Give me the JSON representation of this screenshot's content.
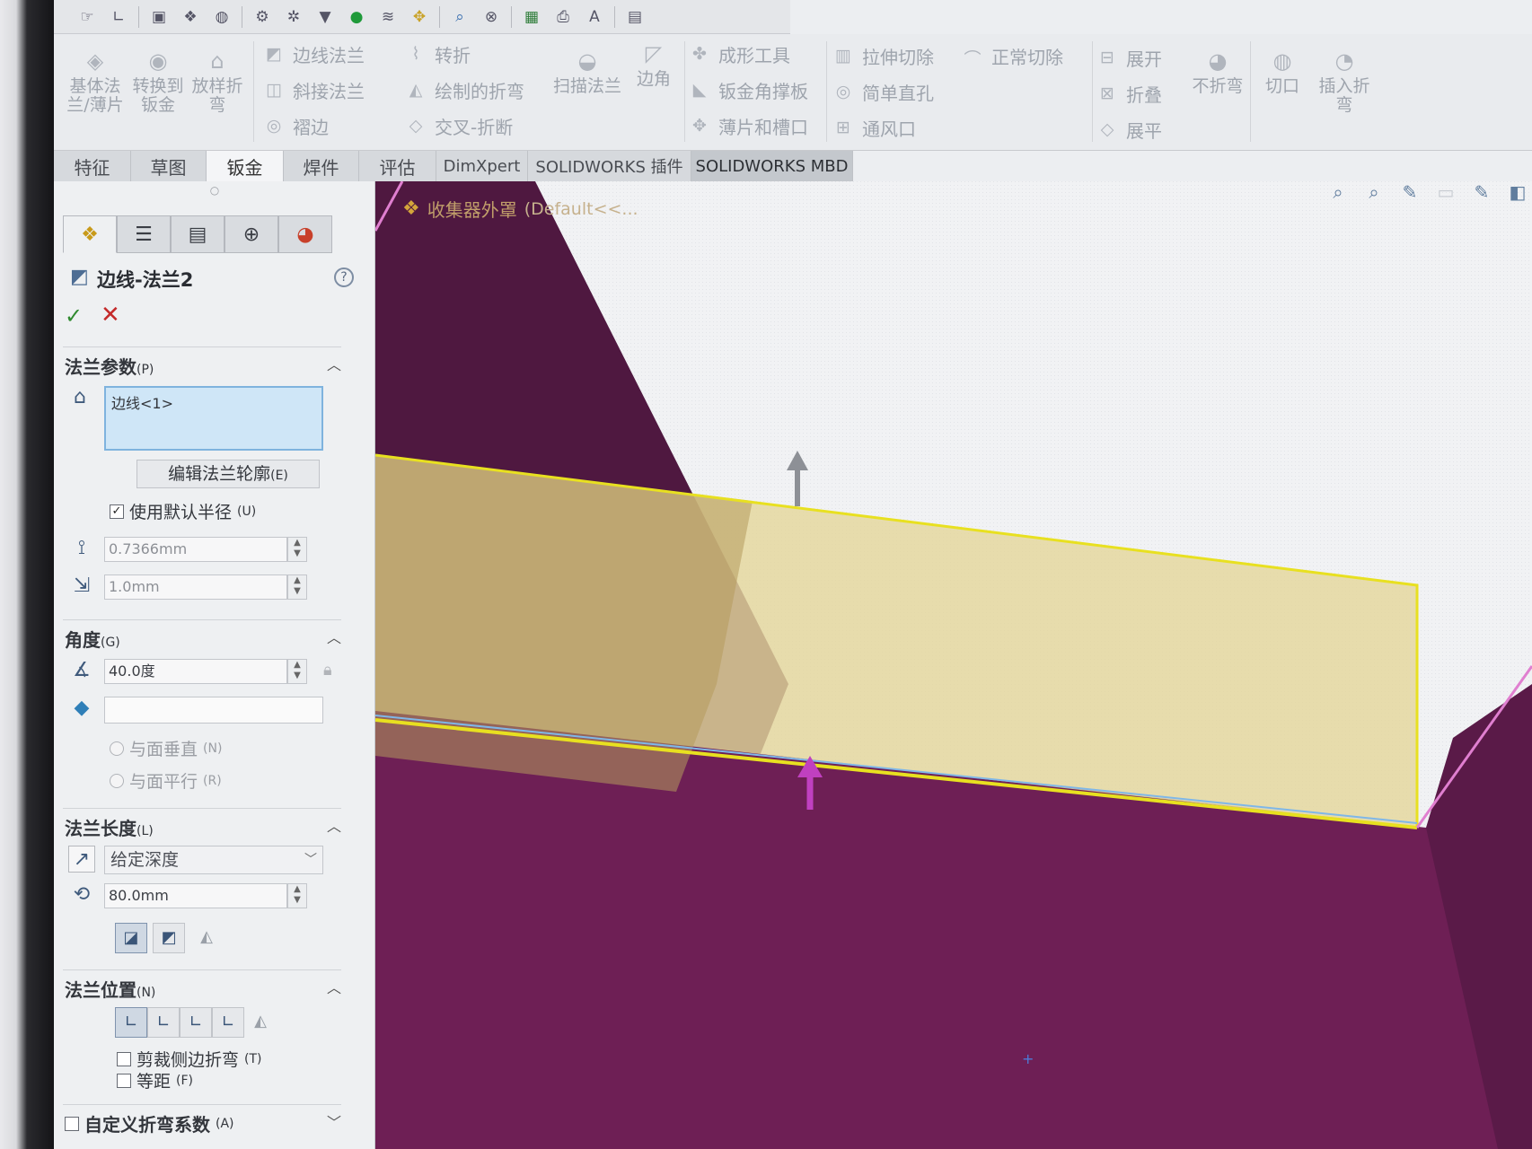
{
  "quick_toolbar": {
    "icons": [
      "pointer-icon",
      "sketch-icon",
      "display-icon",
      "components-icon",
      "globe-icon",
      "gear-icon",
      "settings-icon",
      "funnel-icon",
      "map-pin-icon",
      "spring-icon",
      "move-icon",
      "search-icon",
      "binoculars-icon",
      "excel-icon",
      "print-icon",
      "text-icon",
      "calendar-icon"
    ]
  },
  "ribbon": {
    "base_flange_label": "基体法兰/薄片",
    "convert_to_sheet_label": "转换到钣金",
    "lofted_bend_label": "放样折弯",
    "edge_flange_label": "边线法兰",
    "miter_flange_label": "斜接法兰",
    "hem_label": "褶边",
    "jog_label": "转折",
    "sketched_bend_label": "绘制的折弯",
    "cross_break_label": "交叉-折断",
    "swept_flange_label": "扫描法兰",
    "corner_label": "边角",
    "forming_tool_label": "成形工具",
    "sheet_gusset_label": "钣金角撑板",
    "tab_slot_label": "薄片和槽口",
    "extruded_cut_label": "拉伸切除",
    "simple_hole_label": "简单直孔",
    "vent_label": "通风口",
    "normal_cut_label": "正常切除",
    "unfold_label": "展开",
    "fold_label": "折叠",
    "no_bends_label": "不折弯",
    "rip_label": "切口",
    "insert_bends_label": "插入折弯",
    "flatten_label": "展平"
  },
  "tabs": [
    {
      "label": "特征"
    },
    {
      "label": "草图"
    },
    {
      "label": "钣金"
    },
    {
      "label": "焊件"
    },
    {
      "label": "评估"
    },
    {
      "label": "DimXpert"
    },
    {
      "label": "SOLIDWORKS 插件"
    },
    {
      "label": "SOLIDWORKS MBD"
    }
  ],
  "property_manager": {
    "title": "边线-法兰2",
    "flange_params": {
      "header": "法兰参数",
      "header_key": "(P)",
      "selected_edge": "边线<1>",
      "edit_profile_label": "编辑法兰轮廓",
      "edit_profile_key": "(E)",
      "use_default_radius_label": "使用默认半径",
      "use_default_radius_key": "(U)",
      "bend_radius": "0.7366mm",
      "gap_distance": "1.0mm"
    },
    "angle": {
      "header": "角度",
      "header_key": "(G)",
      "value": "40.0度",
      "perpendicular_label": "与面垂直",
      "perpendicular_key": "(N)",
      "parallel_label": "与面平行",
      "parallel_key": "(R)"
    },
    "flange_length": {
      "header": "法兰长度",
      "header_key": "(L)",
      "end_condition": "给定深度",
      "length": "80.0mm"
    },
    "flange_position": {
      "header": "法兰位置",
      "header_key": "(N)",
      "trim_side_bends_label": "剪裁侧边折弯",
      "trim_side_bends_key": "(T)",
      "offset_label": "等距",
      "offset_key": "(F)"
    },
    "custom_bend_allowance_label": "自定义折弯系数",
    "custom_bend_allowance_key": "(A)"
  },
  "viewport": {
    "part_name": "收集器外罩",
    "config": "(Default<<...",
    "colors": {
      "sheet": "#6e1f55",
      "sheet_dark": "#4f1840",
      "flange_preview": "#e4d79c",
      "flange_edge": "#e8e020",
      "handle": "#c040c0"
    }
  }
}
